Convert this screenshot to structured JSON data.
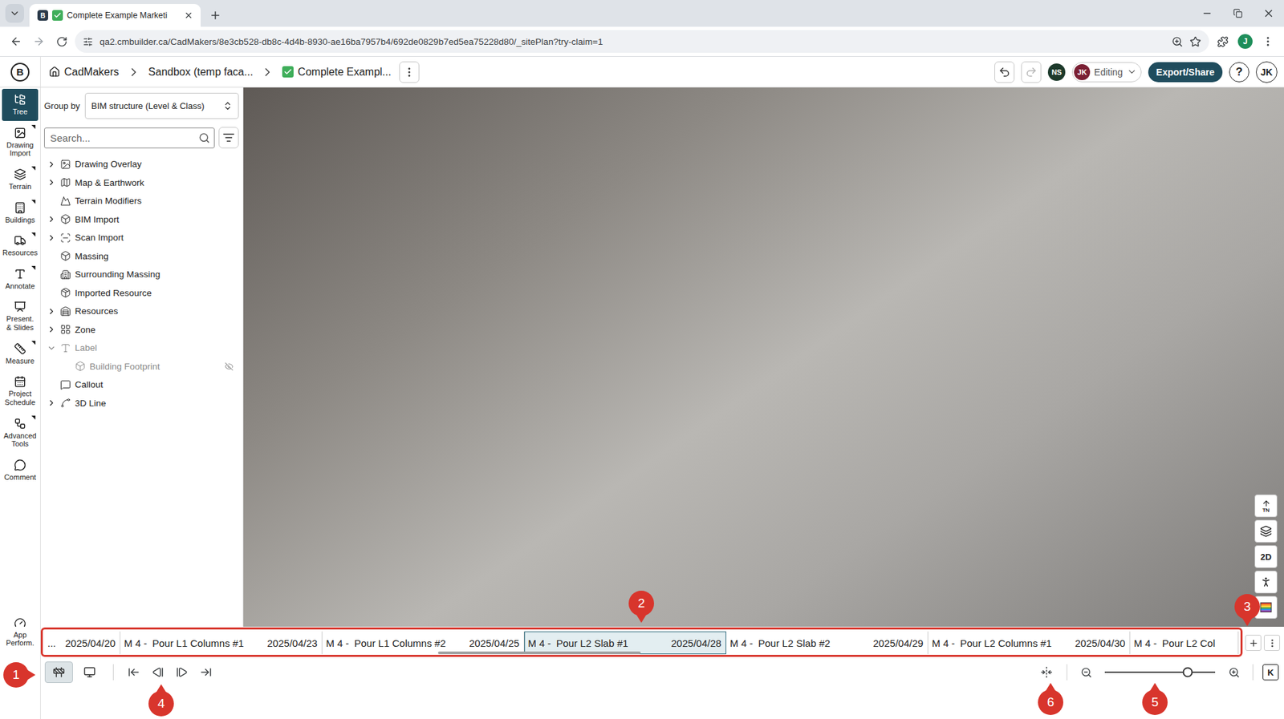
{
  "browser": {
    "tab": {
      "favicon": "B",
      "title": "Complete Example Marketi",
      "selected": true
    },
    "url": "qa2.cmbuilder.ca/CadMakers/8e3cb528-db8c-4d4b-8930-ae16ba7957b4/692de0829b7ed5ea75228d80/_sitePlan?try-claim=1",
    "profile": "J"
  },
  "header": {
    "logo": "B",
    "breadcrumbs": [
      {
        "kind": "home",
        "label": "CadMakers"
      },
      {
        "kind": "folder",
        "label": "Sandbox (temp faca..."
      },
      {
        "kind": "project",
        "label": "Complete Exampl..."
      }
    ],
    "undo_disabled": false,
    "redo_disabled": true,
    "collaborators": [
      {
        "initials": "NS",
        "color": "#1d3a2b"
      }
    ],
    "mode": {
      "initials": "JK",
      "label": "Editing",
      "color": "#7a1f33"
    },
    "export": "Export/Share",
    "help": "?",
    "user": "JK"
  },
  "rail": {
    "items": [
      {
        "label": "Tree",
        "selected": true,
        "menu": false
      },
      {
        "label": "Drawing Import",
        "selected": false,
        "menu": true
      },
      {
        "label": "Terrain",
        "selected": false,
        "menu": true
      },
      {
        "label": "Buildings",
        "selected": false,
        "menu": true
      },
      {
        "label": "Resources",
        "selected": false,
        "menu": true
      },
      {
        "label": "Annotate",
        "selected": false,
        "menu": true
      },
      {
        "label": "Present. & Slides",
        "selected": false,
        "menu": false
      },
      {
        "label": "Measure",
        "selected": false,
        "menu": true
      },
      {
        "label": "Project Schedule",
        "selected": false,
        "menu": false
      },
      {
        "label": "Advanced Tools",
        "selected": false,
        "menu": true
      },
      {
        "label": "Comment",
        "selected": false,
        "menu": false
      }
    ],
    "footer": {
      "label": "App Perform.",
      "selected": false
    }
  },
  "tree": {
    "group_by_label": "Group by",
    "group_by": "BIM structure (Level & Class)",
    "search_placeholder": "Search...",
    "items": [
      {
        "label": "Drawing Overlay",
        "depth": 0,
        "expandable": true,
        "expanded": false,
        "dimmed": false,
        "hidden": false
      },
      {
        "label": "Map & Earthwork",
        "depth": 0,
        "expandable": true,
        "expanded": false,
        "dimmed": false,
        "hidden": false
      },
      {
        "label": "Terrain Modifiers",
        "depth": 0,
        "expandable": false,
        "expanded": false,
        "dimmed": false,
        "hidden": false
      },
      {
        "label": "BIM Import",
        "depth": 0,
        "expandable": true,
        "expanded": false,
        "dimmed": false,
        "hidden": false
      },
      {
        "label": "Scan Import",
        "depth": 0,
        "expandable": true,
        "expanded": false,
        "dimmed": false,
        "hidden": false
      },
      {
        "label": "Massing",
        "depth": 0,
        "expandable": false,
        "expanded": false,
        "dimmed": false,
        "hidden": false
      },
      {
        "label": "Surrounding Massing",
        "depth": 0,
        "expandable": false,
        "expanded": false,
        "dimmed": false,
        "hidden": false
      },
      {
        "label": "Imported Resource",
        "depth": 0,
        "expandable": false,
        "expanded": false,
        "dimmed": false,
        "hidden": false
      },
      {
        "label": "Resources",
        "depth": 0,
        "expandable": true,
        "expanded": false,
        "dimmed": false,
        "hidden": false
      },
      {
        "label": "Zone",
        "depth": 0,
        "expandable": true,
        "expanded": false,
        "dimmed": false,
        "hidden": false
      },
      {
        "label": "Label",
        "depth": 0,
        "expandable": true,
        "expanded": true,
        "dimmed": true,
        "hidden": false
      },
      {
        "label": "Building Footprint",
        "depth": 1,
        "expandable": false,
        "expanded": false,
        "dimmed": true,
        "hidden": true
      },
      {
        "label": "Callout",
        "depth": 0,
        "expandable": false,
        "expanded": false,
        "dimmed": false,
        "hidden": false
      },
      {
        "label": "3D Line",
        "depth": 0,
        "expandable": true,
        "expanded": false,
        "dimmed": false,
        "hidden": false
      }
    ]
  },
  "view_tools": [
    {
      "kind": "north",
      "label": "TN"
    },
    {
      "kind": "layers",
      "label": ""
    },
    {
      "kind": "mode",
      "label": "2D"
    },
    {
      "kind": "walk",
      "label": ""
    },
    {
      "kind": "palette",
      "label": ""
    }
  ],
  "timeline": {
    "segments": [
      {
        "kind": "start",
        "prefix": "",
        "name": "...",
        "date": "2025/04/20",
        "selected": false
      },
      {
        "kind": "full",
        "prefix": "M 4 -",
        "name": "Pour L1 Columns #1",
        "date": "2025/04/23",
        "selected": false
      },
      {
        "kind": "full",
        "prefix": "M 4 -",
        "name": "Pour L1 Columns #2",
        "date": "2025/04/25",
        "selected": false
      },
      {
        "kind": "full",
        "prefix": "M 4 -",
        "name": "Pour L2 Slab #1",
        "date": "2025/04/28",
        "selected": true
      },
      {
        "kind": "full",
        "prefix": "M 4 -",
        "name": "Pour L2 Slab #2",
        "date": "2025/04/29",
        "selected": false
      },
      {
        "kind": "full",
        "prefix": "M 4 -",
        "name": "Pour L2 Columns #1",
        "date": "2025/04/30",
        "selected": false
      },
      {
        "kind": "end",
        "prefix": "M 4 -",
        "name": "Pour L2 Col",
        "date": "",
        "selected": false
      }
    ],
    "scrollbar": {
      "offset": 0.33,
      "size": 0.17
    }
  },
  "toolbar": {
    "modes": [
      {
        "kind": "site",
        "selected": true
      },
      {
        "kind": "slides",
        "selected": false
      }
    ],
    "zoom_level": 0.75,
    "key": "K"
  },
  "annotations": [
    "1",
    "2",
    "3",
    "4",
    "5",
    "6"
  ]
}
